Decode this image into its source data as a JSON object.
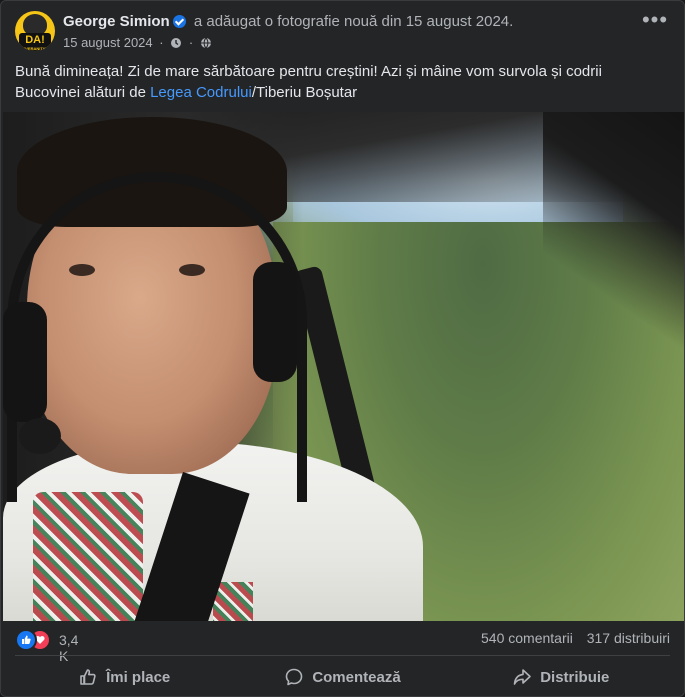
{
  "post": {
    "author": "George Simion",
    "action_text": "a adăugat o fotografie nouă din 15 august 2024.",
    "date": "15 august 2024",
    "text_before_link": "Bună dimineața! Zi de mare sărbătoare pentru creștini! Azi și mâine vom survola și codrii Bucovinei alături de ",
    "link_text": "Legea Codrului",
    "text_after_link": "/Tiberiu Boșutar",
    "avatar_text": "DA!",
    "avatar_subtext": "SUVERANITATE"
  },
  "stats": {
    "reactions_count": "3,4 K",
    "comments": "540 comentarii",
    "shares": "317 distribuiri"
  },
  "actions": {
    "like_label": "Îmi place",
    "comment_label": "Comentează",
    "share_label": "Distribuie"
  },
  "colors": {
    "card_bg": "#242526",
    "link": "#4599ff",
    "like_blue": "#1877f2",
    "love_red": "#f33e58"
  },
  "icons": [
    "verified-badge-icon",
    "clock-icon",
    "globe-icon",
    "more-options-icon",
    "like-reaction-icon",
    "love-reaction-icon",
    "thumbs-up-icon",
    "comment-icon",
    "share-icon"
  ]
}
